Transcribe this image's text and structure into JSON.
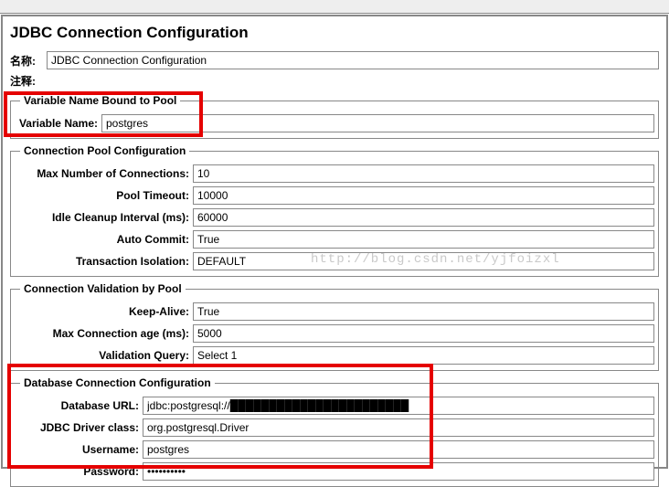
{
  "title": "JDBC Connection Configuration",
  "nameLabel": "名称:",
  "nameValue": "JDBC Connection Configuration",
  "commentLabel": "注释:",
  "varPool": {
    "legend": "Variable Name Bound to Pool",
    "variableName": {
      "label": "Variable Name:",
      "value": "postgres"
    }
  },
  "pool": {
    "legend": "Connection Pool Configuration",
    "maxConn": {
      "label": "Max Number of Connections:",
      "value": "10"
    },
    "poolTimeout": {
      "label": "Pool Timeout:",
      "value": "10000"
    },
    "idleCleanup": {
      "label": "Idle Cleanup Interval (ms):",
      "value": "60000"
    },
    "autoCommit": {
      "label": "Auto Commit:",
      "value": "True"
    },
    "txIsolation": {
      "label": "Transaction Isolation:",
      "value": "DEFAULT"
    }
  },
  "valid": {
    "legend": "Connection Validation by Pool",
    "keepAlive": {
      "label": "Keep-Alive:",
      "value": "True"
    },
    "maxAge": {
      "label": "Max Connection age (ms):",
      "value": "5000"
    },
    "query": {
      "label": "Validation Query:",
      "value": "Select 1"
    }
  },
  "db": {
    "legend": "Database Connection Configuration",
    "url": {
      "label": "Database URL:",
      "value": "jdbc:postgresql://███████████████████████"
    },
    "driver": {
      "label": "JDBC Driver class:",
      "value": "org.postgresql.Driver"
    },
    "user": {
      "label": "Username:",
      "value": "postgres"
    },
    "pass": {
      "label": "Password:",
      "value": "••••••••••"
    }
  },
  "watermark": "http://blog.csdn.net/yjfoizxl"
}
